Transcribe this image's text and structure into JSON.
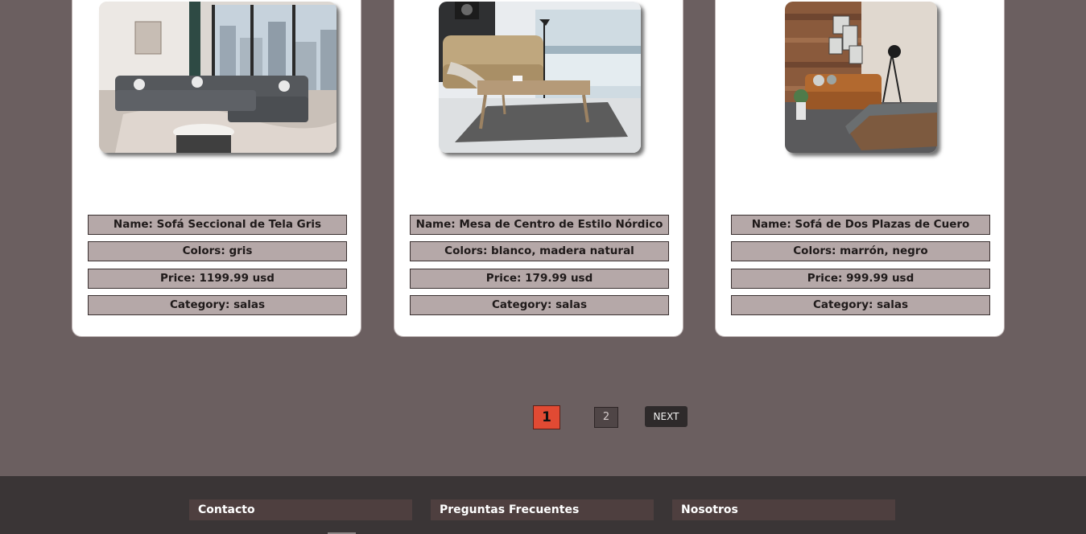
{
  "products": [
    {
      "name": "Name: Sofá Seccional de Tela Gris",
      "colors": "Colors: gris",
      "price": "Price: 1199.99 usd",
      "category": "Category: salas",
      "image_alt": "sofa-seccional-gris"
    },
    {
      "name": "Name: Mesa de Centro de Estilo Nórdico",
      "colors": "Colors: blanco, madera natural",
      "price": "Price: 179.99 usd",
      "category": "Category: salas",
      "image_alt": "mesa-centro-nordico"
    },
    {
      "name": "Name: Sofá de Dos Plazas de Cuero",
      "colors": "Colors: marrón, negro",
      "price": "Price: 999.99 usd",
      "category": "Category: salas",
      "image_alt": "sofa-dos-plazas-cuero"
    }
  ],
  "pagination": {
    "current": "1",
    "page2": "2",
    "next_label": "NEXT"
  },
  "footer": {
    "contact": "Contacto",
    "faq": "Preguntas Frecuentes",
    "about": "Nosotros"
  },
  "colors": {
    "page_bg": "#6b5f60",
    "card_bg": "#ffffff",
    "field_bg": "#b5a8a8",
    "active_page": "#e14a33",
    "footer_bg": "#3a3536",
    "footer_heading_bg": "#4e3f3f"
  }
}
